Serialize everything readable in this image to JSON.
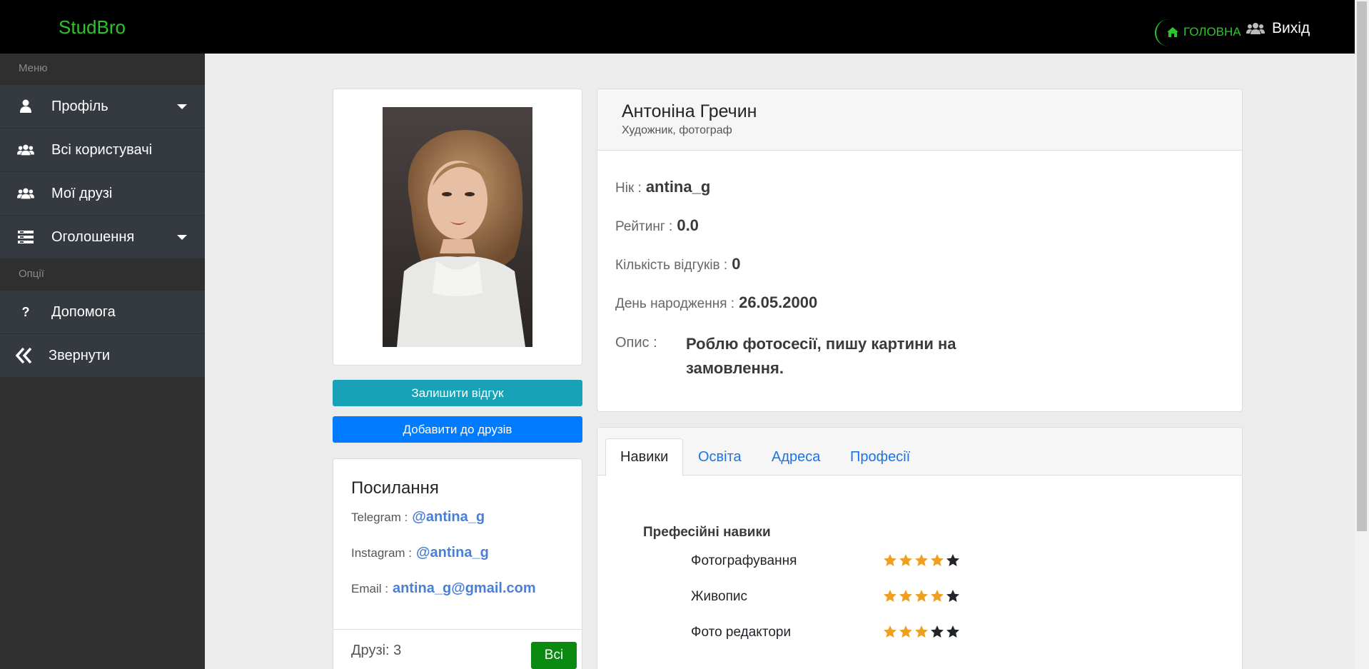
{
  "header": {
    "brand": "StudBro",
    "home_label": "ГОЛОВНА",
    "logout_label": "Вихід"
  },
  "sidebar": {
    "menu_heading": "Меню",
    "items": [
      {
        "label": "Профіль",
        "icon": "user-icon"
      },
      {
        "label": "Всі користувачі",
        "icon": "users-icon"
      },
      {
        "label": "Мої друзі",
        "icon": "users-icon"
      },
      {
        "label": "Оголошення",
        "icon": "list-icon"
      }
    ],
    "options_heading": "Опції",
    "options": [
      {
        "label": "Допомога",
        "icon": "question-icon"
      },
      {
        "label": "Звернути",
        "icon": "double-chevron-left-icon"
      }
    ]
  },
  "actions": {
    "review_label": "Залишити відгук",
    "add_friend_label": "Добавити до друзів"
  },
  "links": {
    "title": "Посилання",
    "telegram_label": "Telegram :",
    "telegram_value": "@antina_g",
    "instagram_label": "Instagram :",
    "instagram_value": "@antina_g",
    "email_label": "Email :",
    "email_value": "antina_g@gmail.com",
    "friends_label": "Друзі: 3",
    "all_button": "Всі"
  },
  "profile": {
    "name": "Антоніна Гречин",
    "subtitle": "Художник, фотограф",
    "nick_label": "Нік :",
    "nick_value": "antina_g",
    "rating_label": "Рейтинг :",
    "rating_value": "0.0",
    "reviews_label": "Кількість відгуків :",
    "reviews_value": "0",
    "birthday_label": "День народження :",
    "birthday_value": "26.05.2000",
    "description_label": "Опис :",
    "description_value": "Роблю фотосесії, пишу картини на замовлення."
  },
  "tabs": [
    {
      "label": "Навики",
      "active": true
    },
    {
      "label": "Освіта"
    },
    {
      "label": "Адреса"
    },
    {
      "label": "Професії"
    }
  ],
  "skills": {
    "title": "Префесійні навики",
    "items": [
      {
        "name": "Фотографування",
        "rating": 4,
        "max": 5
      },
      {
        "name": "Живопис",
        "rating": 4,
        "max": 5
      },
      {
        "name": "Фото редактори",
        "rating": 3,
        "max": 5
      }
    ]
  },
  "colors": {
    "brand": "#2cc52c",
    "star_filled": "#f0a020",
    "star_empty": "#212529"
  }
}
